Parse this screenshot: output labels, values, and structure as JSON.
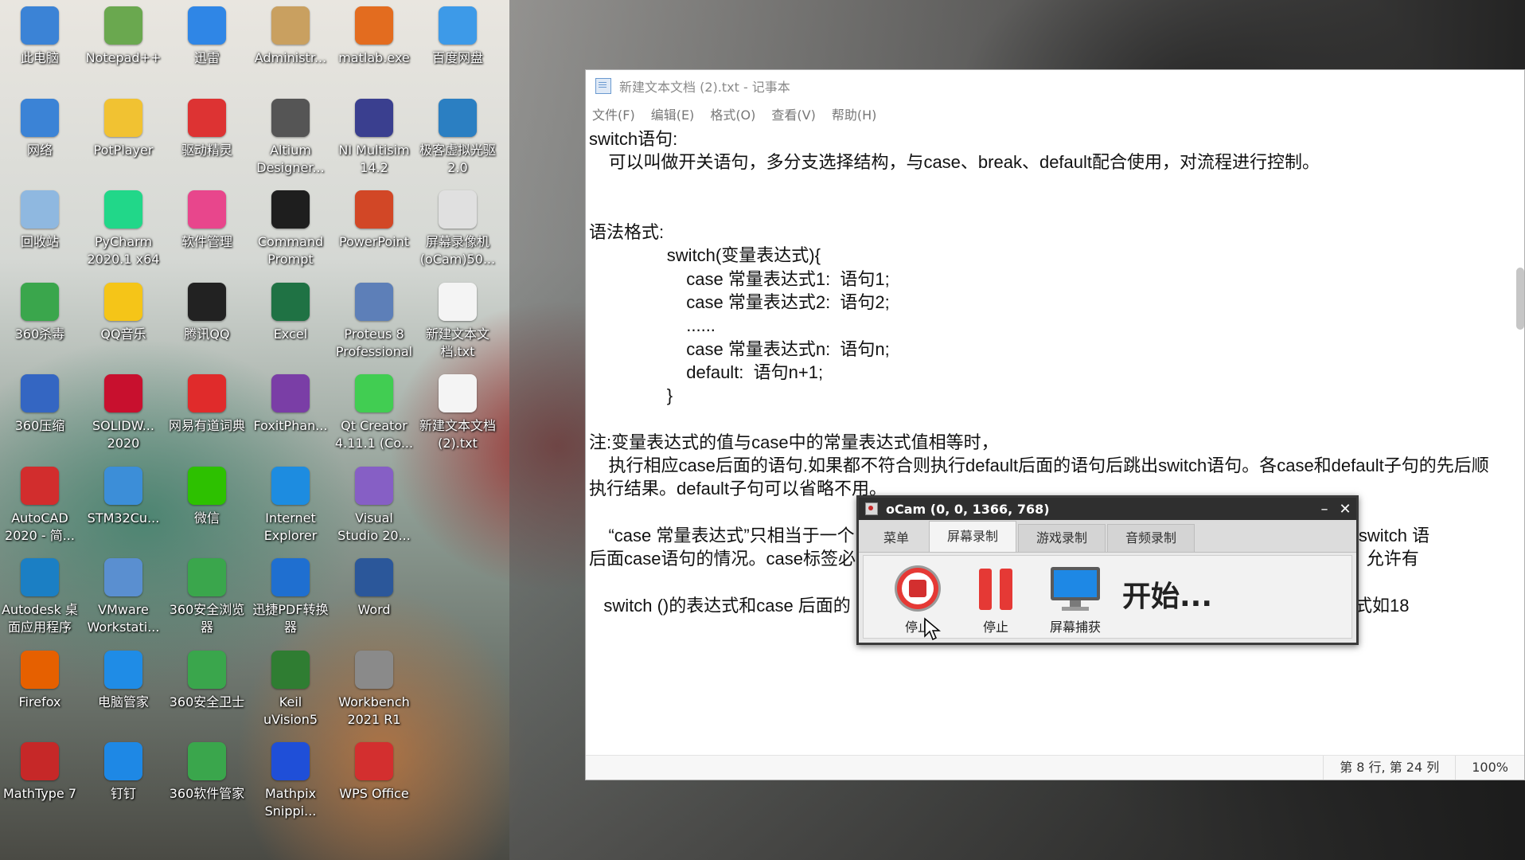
{
  "desktop": {
    "icons": [
      {
        "label": "此电脑",
        "icon": "computer-icon",
        "color": "#3b83d6"
      },
      {
        "label": "Notepad++",
        "icon": "notepad-plus-icon",
        "color": "#6aa84f"
      },
      {
        "label": "迅雷",
        "icon": "thunder-icon",
        "color": "#2f86e6"
      },
      {
        "label": "Administr...",
        "icon": "user-folder-icon",
        "color": "#c9a060"
      },
      {
        "label": "matlab.exe",
        "icon": "matlab-icon",
        "color": "#e36c1f"
      },
      {
        "label": "百度网盘",
        "icon": "baidu-netdisk-icon",
        "color": "#3d9ae8"
      },
      {
        "label": "网络",
        "icon": "network-icon",
        "color": "#3b83d6"
      },
      {
        "label": "PotPlayer",
        "icon": "potplayer-icon",
        "color": "#f1c232"
      },
      {
        "label": "驱动精灵",
        "icon": "driver-genius-icon",
        "color": "#d33"
      },
      {
        "label": "Altium Designer...",
        "icon": "altium-icon",
        "color": "#555"
      },
      {
        "label": "NI Multisim 14.2",
        "icon": "multisim-icon",
        "color": "#3a3f8f"
      },
      {
        "label": "极客虚拟光驱2.0",
        "icon": "virtual-drive-icon",
        "color": "#2b7fc2"
      },
      {
        "label": "回收站",
        "icon": "recycle-bin-icon",
        "color": "#8fb8e0"
      },
      {
        "label": "PyCharm 2020.1 x64",
        "icon": "pycharm-icon",
        "color": "#21d789"
      },
      {
        "label": "软件管理",
        "icon": "software-manager-icon",
        "color": "#e8468c"
      },
      {
        "label": "Command Prompt",
        "icon": "cmd-icon",
        "color": "#1e1e1e"
      },
      {
        "label": "PowerPoint",
        "icon": "powerpoint-icon",
        "color": "#d24726"
      },
      {
        "label": "屏幕录像机(oCam)50...",
        "icon": "ocam-icon",
        "color": "#e0e0e0"
      },
      {
        "label": "360杀毒",
        "icon": "antivirus-360-icon",
        "color": "#3aa64c"
      },
      {
        "label": "QQ音乐",
        "icon": "qq-music-icon",
        "color": "#f5c518"
      },
      {
        "label": "腾讯QQ",
        "icon": "qq-icon",
        "color": "#222"
      },
      {
        "label": "Excel",
        "icon": "excel-icon",
        "color": "#1f7244"
      },
      {
        "label": "Proteus 8 Professional",
        "icon": "proteus-icon",
        "color": "#5d7fb8"
      },
      {
        "label": "新建文本文档.txt",
        "icon": "text-file-icon",
        "color": "#f4f4f4"
      },
      {
        "label": "360压缩",
        "icon": "zip-360-icon",
        "color": "#3466c2"
      },
      {
        "label": "SOLIDW... 2020",
        "icon": "solidworks-icon",
        "color": "#c8102e"
      },
      {
        "label": "网易有道词典",
        "icon": "youdao-icon",
        "color": "#e02b2b"
      },
      {
        "label": "FoxitPhan...",
        "icon": "foxit-icon",
        "color": "#7a3ea6"
      },
      {
        "label": "Qt Creator 4.11.1 (Co...",
        "icon": "qt-creator-icon",
        "color": "#41cd52"
      },
      {
        "label": "新建文本文档 (2).txt",
        "icon": "text-file-icon",
        "color": "#f4f4f4"
      },
      {
        "label": "AutoCAD 2020 - 简...",
        "icon": "autocad-icon",
        "color": "#d22d2d"
      },
      {
        "label": "STM32Cu...",
        "icon": "stm32cube-icon",
        "color": "#3c8ed8"
      },
      {
        "label": "微信",
        "icon": "wechat-icon",
        "color": "#2dc100"
      },
      {
        "label": "Internet Explorer",
        "icon": "ie-icon",
        "color": "#1d8ce0"
      },
      {
        "label": "Visual Studio 20...",
        "icon": "visual-studio-icon",
        "color": "#865fc5"
      },
      {
        "label": "Autodesk 桌面应用程序",
        "icon": "autodesk-icon",
        "color": "#1b7fc4"
      },
      {
        "label": "VMware Workstati...",
        "icon": "vmware-icon",
        "color": "#5a8fd0"
      },
      {
        "label": "360安全浏览器",
        "icon": "browser-360-icon",
        "color": "#3aa64c"
      },
      {
        "label": "迅捷PDF转换器",
        "icon": "pdf-converter-icon",
        "color": "#1f6fd0"
      },
      {
        "label": "Word",
        "icon": "word-icon",
        "color": "#2b579a"
      },
      {
        "label": "Firefox",
        "icon": "firefox-icon",
        "color": "#e66000"
      },
      {
        "label": "电脑管家",
        "icon": "pc-manager-icon",
        "color": "#1f8ce6"
      },
      {
        "label": "360安全卫士",
        "icon": "security-360-icon",
        "color": "#3aa64c"
      },
      {
        "label": "Keil uVision5",
        "icon": "keil-icon",
        "color": "#2f7d32"
      },
      {
        "label": "Workbench 2021 R1",
        "icon": "workbench-icon",
        "color": "#8a8a8a"
      },
      {
        "label": "MathType 7",
        "icon": "mathtype-icon",
        "color": "#c62828"
      },
      {
        "label": "钉钉",
        "icon": "dingtalk-icon",
        "color": "#1e88e5"
      },
      {
        "label": "360软件管家",
        "icon": "software-360-icon",
        "color": "#3aa64c"
      },
      {
        "label": "Mathpix Snippi...",
        "icon": "mathpix-icon",
        "color": "#1f4fd8"
      },
      {
        "label": "WPS Office",
        "icon": "wps-icon",
        "color": "#d32f2f"
      }
    ]
  },
  "notepad": {
    "title": "新建文本文档 (2).txt - 记事本",
    "menu": [
      "文件(F)",
      "编辑(E)",
      "格式(O)",
      "查看(V)",
      "帮助(H)"
    ],
    "lines": [
      "switch语句:",
      "    可以叫做开关语句，多分支选择结构，与case、break、default配合使用，对流程进行控制。",
      "",
      "",
      "语法格式:",
      "                switch(变量表达式){",
      "                    case 常量表达式1:  语句1;",
      "                    case 常量表达式2:  语句2;",
      "                    ......",
      "                    case 常量表达式n:  语句n;",
      "                    default:  语句n+1;",
      "                }",
      "",
      "注:变量表达式的值与case中的常量表达式值相等时，",
      "    执行相应case后面的语句.如果都不符合则执行default后面的语句后跳出switch语句。各case和default子句的先后顺",
      "执行结果。default子句可以省略不用。",
      "",
      "    “case 常量表达式”只相当于一个                                                                                  自动跳出整个switch 语",
      "后面case语句的情况。case标签必                                                                                   。在case后，允许有",
      "",
      "   switch ()的表达式和case 后面的                                                                                  值；常量表达式如18"
    ],
    "status": {
      "position": "第 8 行, 第 24 列",
      "zoom": "100%"
    }
  },
  "ocam": {
    "title": "oCam (0, 0, 1366, 768)",
    "minimize": "–",
    "close": "✕",
    "tabs": [
      "菜单",
      "屏幕录制",
      "游戏录制",
      "音频录制"
    ],
    "tools": [
      {
        "label": "停止",
        "icon": "record-stop-icon"
      },
      {
        "label": "停止",
        "icon": "pause-icon"
      },
      {
        "label": "屏幕捕获",
        "icon": "screen-capture-icon"
      }
    ],
    "status_text": "开始..."
  }
}
